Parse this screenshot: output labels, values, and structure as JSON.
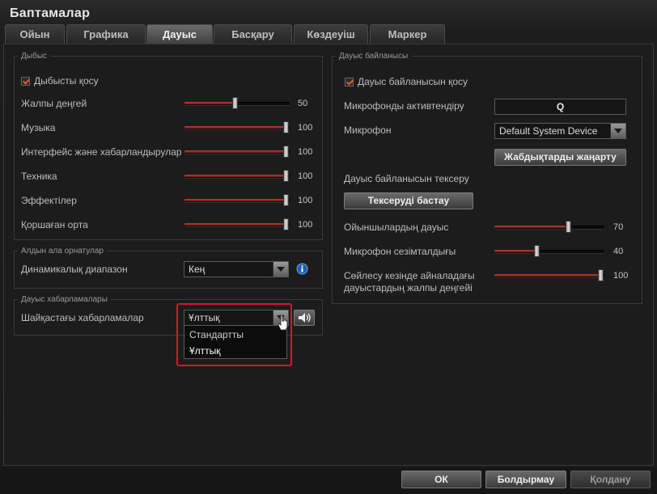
{
  "window": {
    "title": "Баптамалар"
  },
  "tabs": [
    {
      "label": "Ойын"
    },
    {
      "label": "Графика"
    },
    {
      "label": "Дауыс"
    },
    {
      "label": "Басқару"
    },
    {
      "label": "Көздеуіш"
    },
    {
      "label": "Маркер"
    }
  ],
  "active_tab": "Дауыс",
  "sound": {
    "legend": "Дыбыс",
    "enable_label": "Дыбысты қосу",
    "enable_checked": true,
    "sliders": [
      {
        "label": "Жалпы деңгей",
        "value": "50",
        "level": 0.5
      },
      {
        "label": "Музыка",
        "value": "100",
        "level": 1.0
      },
      {
        "label": "Интерфейс және хабарландырулар",
        "value": "100",
        "level": 1.0
      },
      {
        "label": "Техника",
        "value": "100",
        "level": 1.0
      },
      {
        "label": "Эффектілер",
        "value": "100",
        "level": 1.0
      },
      {
        "label": "Қоршаған орта",
        "value": "100",
        "level": 1.0
      }
    ]
  },
  "presets": {
    "legend": "Алдын ала орнатулар",
    "dynamic_range_label": "Динамикалық диапазон",
    "dynamic_range_value": "Кең"
  },
  "voice_messages": {
    "legend": "Дауыс хабарламалары",
    "battle_label": "Шайқастағы хабарламалар",
    "selected": "Ұлттық",
    "options": [
      "Стандартты",
      "Ұлттық"
    ]
  },
  "voice_chat": {
    "legend": "Дауыс байланысы",
    "enable_label": "Дауыс байланысын қосу",
    "enable_checked": true,
    "mic_activate_label": "Микрофонды активтендіру",
    "mic_activate_key": "Q",
    "mic_label": "Микрофон",
    "mic_device": "Default System Device",
    "refresh_button": "Жабдықтарды жаңарту",
    "test_label": "Дауыс байланысын тексеру",
    "test_button": "Тексеруді бастау",
    "sliders": [
      {
        "label": "Ойыншылардың дауыс",
        "value": "70",
        "level": 0.7
      },
      {
        "label": "Микрофон сезімталдығы",
        "value": "40",
        "level": 0.4
      },
      {
        "label": "Сөйлесу кезінде айналадағы дауыстардың жалпы деңгейі",
        "value": "100",
        "level": 1.0
      }
    ]
  },
  "footer": {
    "ok": "ОК",
    "cancel": "Болдырмау",
    "apply": "Қолдану"
  },
  "colors": {
    "accent": "#c23a2e",
    "highlight": "#d6182a"
  }
}
